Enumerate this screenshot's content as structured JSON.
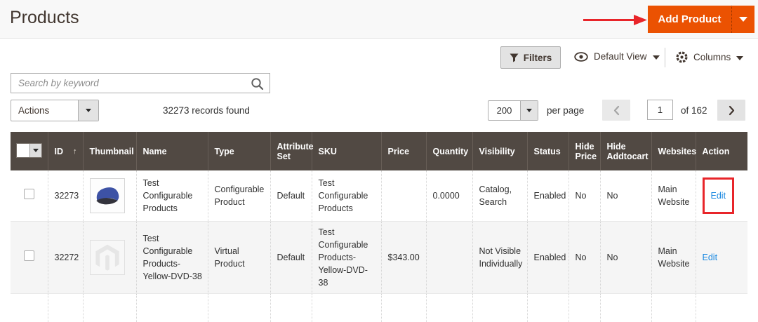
{
  "colors": {
    "accent_orange": "#eb5202",
    "annotation_red": "#e8252a",
    "link_blue": "#1787e0",
    "grid_header_bg": "#514943"
  },
  "page": {
    "title": "Products"
  },
  "header": {
    "add_product_label": "Add Product"
  },
  "grid_toolbar": {
    "filters_label": "Filters",
    "view_label": "Default View",
    "columns_label": "Columns"
  },
  "search": {
    "placeholder": "Search by keyword",
    "value": ""
  },
  "actions_bar": {
    "actions_label": "Actions",
    "records_found": "32273 records found"
  },
  "pagination": {
    "per_page_value": "200",
    "per_page_label": "per page",
    "current_page": "1",
    "total_label": "of 162"
  },
  "grid": {
    "id_sort_indicator": "↑",
    "columns": [
      "ID",
      "Thumbnail",
      "Name",
      "Type",
      "Attribute Set",
      "SKU",
      "Price",
      "Quantity",
      "Visibility",
      "Status",
      "Hide Price",
      "Hide Addtocart",
      "Websites",
      "Action"
    ],
    "rows": [
      {
        "id": "32273",
        "thumbnail": "blue-cap",
        "name": "Test Configurable Products",
        "type": "Configurable Product",
        "attribute_set": "Default",
        "sku": "Test Configurable Products",
        "price": "",
        "quantity": "0.0000",
        "visibility": "Catalog, Search",
        "status": "Enabled",
        "hide_price": "No",
        "hide_addtocart": "No",
        "websites": "Main Website",
        "action": "Edit"
      },
      {
        "id": "32272",
        "thumbnail": "magento-placeholder",
        "name": "Test Configurable Products-Yellow-DVD-38",
        "type": "Virtual Product",
        "attribute_set": "Default",
        "sku": "Test Configurable Products-Yellow-DVD-38",
        "price": "$343.00",
        "quantity": "",
        "visibility": "Not Visible Individually",
        "status": "Enabled",
        "hide_price": "No",
        "hide_addtocart": "No",
        "websites": "Main Website",
        "action": "Edit"
      }
    ]
  }
}
